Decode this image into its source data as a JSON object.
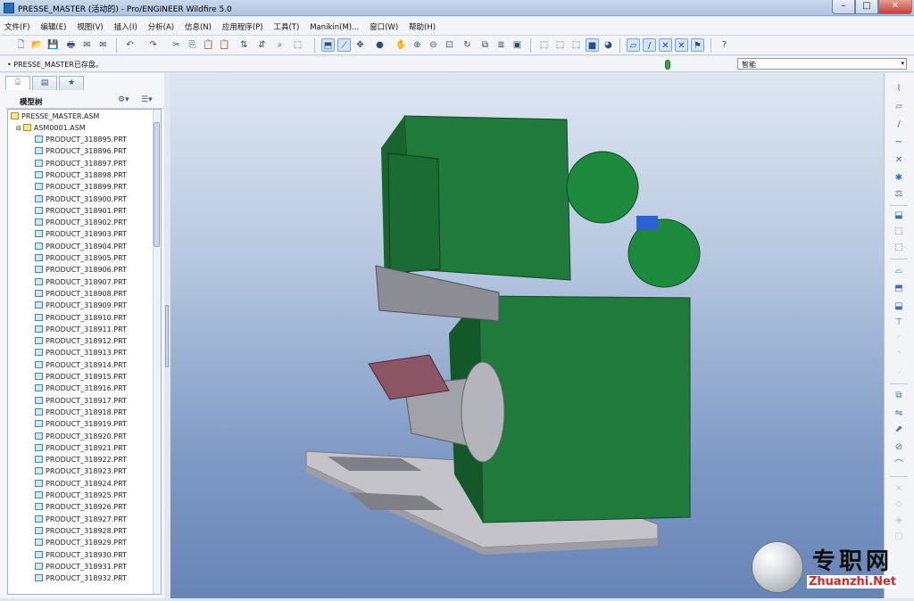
{
  "window": {
    "title": "PRESSE_MASTER (活动的) - Pro/ENGINEER Wildfire 5.0",
    "min": "–",
    "max": "□",
    "close": "✕"
  },
  "menu": [
    "文件(F)",
    "编辑(E)",
    "视图(V)",
    "插入(I)",
    "分析(A)",
    "信息(N)",
    "应用程序(P)",
    "工具(T)",
    "Manikin(M)...",
    "窗口(W)",
    "帮助(H)"
  ],
  "status": {
    "message": "• PRESSE_MASTER已存盘。",
    "filter_value": "智能",
    "filter_arrow": "▾"
  },
  "panel": {
    "tabs": [
      {
        "icon": "model-tree-tab-icon",
        "glyph": "⌸"
      },
      {
        "icon": "folder-browser-tab-icon",
        "glyph": "▤"
      },
      {
        "icon": "favorites-tab-icon",
        "glyph": "★"
      }
    ],
    "tree_title": "模型树",
    "settings_glyph": "⚙▾",
    "show_glyph": "☰▾"
  },
  "tree": {
    "root": "PRESSE_MASTER.ASM",
    "subassembly": "ASM0001.ASM",
    "parts": [
      "PRODUCT_318895.PRT",
      "PRODUCT_318896.PRT",
      "PRODUCT_318897.PRT",
      "PRODUCT_318898.PRT",
      "PRODUCT_318899.PRT",
      "PRODUCT_318900.PRT",
      "PRODUCT_318901.PRT",
      "PRODUCT_318902.PRT",
      "PRODUCT_318903.PRT",
      "PRODUCT_318904.PRT",
      "PRODUCT_318905.PRT",
      "PRODUCT_318906.PRT",
      "PRODUCT_318907.PRT",
      "PRODUCT_318908.PRT",
      "PRODUCT_318909.PRT",
      "PRODUCT_318910.PRT",
      "PRODUCT_318911.PRT",
      "PRODUCT_318912.PRT",
      "PRODUCT_318913.PRT",
      "PRODUCT_318914.PRT",
      "PRODUCT_318915.PRT",
      "PRODUCT_318916.PRT",
      "PRODUCT_318917.PRT",
      "PRODUCT_318918.PRT",
      "PRODUCT_318919.PRT",
      "PRODUCT_318920.PRT",
      "PRODUCT_318921.PRT",
      "PRODUCT_318922.PRT",
      "PRODUCT_318923.PRT",
      "PRODUCT_318924.PRT",
      "PRODUCT_318925.PRT",
      "PRODUCT_318926.PRT",
      "PRODUCT_318927.PRT",
      "PRODUCT_318928.PRT",
      "PRODUCT_318929.PRT",
      "PRODUCT_318930.PRT",
      "PRODUCT_318931.PRT",
      "PRODUCT_318932.PRT"
    ]
  },
  "colors": {
    "model_green": "#1f7a3b",
    "model_green_dark": "#14582a",
    "base_gray": "#b9b9bf",
    "viewport_top": "#dfe6f2",
    "viewport_bottom": "#6784b6",
    "accent": "#3a6fb0"
  },
  "watermark": {
    "cn": "专职网",
    "en": "Zhuanzhi.Net"
  }
}
